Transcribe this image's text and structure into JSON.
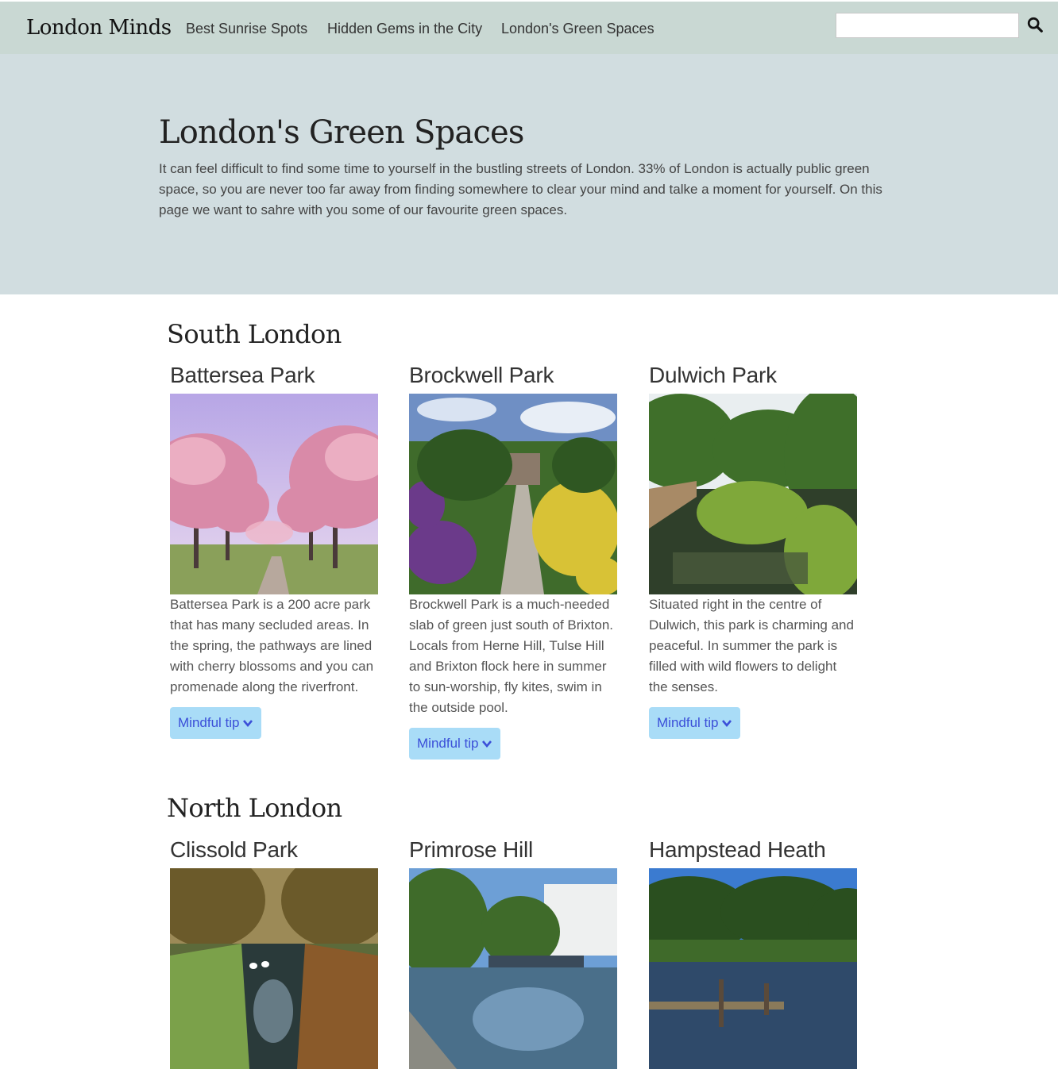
{
  "navbar": {
    "brand": "London Minds",
    "links": [
      "Best Sunrise Spots",
      "Hidden Gems in the City",
      "London's Green Spaces"
    ],
    "search_value": ""
  },
  "hero": {
    "title": "London's Green Spaces",
    "text": "It can feel difficult to find some time to yourself in the bustling streets of London. 33% of London is actually public green space, so you are never too far away from finding somewhere to clear your mind and talke a moment for yourself. On this page we want to sahre with you some of our favourite green spaces."
  },
  "sections": [
    {
      "title": "South London",
      "cards": [
        {
          "title": "Battersea Park",
          "text": "Battersea Park is a 200 acre park that has many secluded areas. In the spring, the pathways are lined with cherry blossoms and you can promenade along the riverfront.",
          "button": "Mindful tip"
        },
        {
          "title": "Brockwell Park",
          "text": "Brockwell Park is a much-needed slab of green just south of Brixton. Locals from Herne Hill, Tulse Hill and Brixton flock here in summer to sun-worship, fly kites, swim in the outside pool.",
          "button": "Mindful tip"
        },
        {
          "title": "Dulwich Park",
          "text": "Situated right in the centre of Dulwich, this park is charming and peaceful. In summer the park is filled with wild flowers to delight the senses.",
          "button": "Mindful tip"
        }
      ]
    },
    {
      "title": "North London",
      "cards": [
        {
          "title": "Clissold Park"
        },
        {
          "title": "Primrose Hill"
        },
        {
          "title": "Hampstead Heath"
        }
      ]
    }
  ],
  "colors": {
    "navbar": "#c9d8d3",
    "hero": "#d1dde0",
    "button_bg": "#a9dcf7",
    "button_text": "#3b4fd8"
  }
}
